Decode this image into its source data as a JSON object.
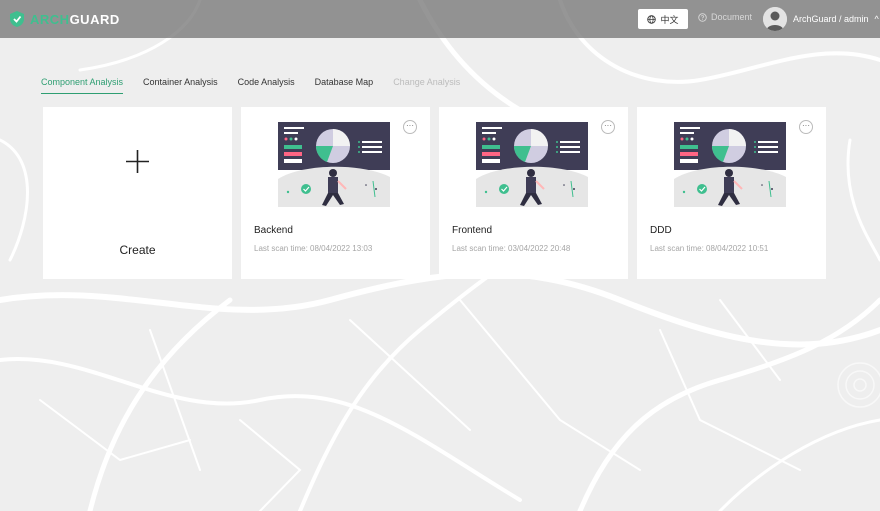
{
  "header": {
    "logo_text_a": "ARCH",
    "logo_text_b": "GUARD",
    "language_label": "中文",
    "document_label": "Document",
    "user_label": "ArchGuard / admin",
    "caret": "^"
  },
  "tabs": [
    {
      "label": "Component Analysis",
      "state": "active"
    },
    {
      "label": "Container Analysis",
      "state": "normal"
    },
    {
      "label": "Code Analysis",
      "state": "normal"
    },
    {
      "label": "Database Map",
      "state": "normal"
    },
    {
      "label": "Change Analysis",
      "state": "disabled"
    }
  ],
  "create_card": {
    "label": "Create"
  },
  "systems": [
    {
      "name": "Backend",
      "last_scan": "Last scan time: 08/04/2022 13:03"
    },
    {
      "name": "Frontend",
      "last_scan": "Last scan time: 03/04/2022 20:48"
    },
    {
      "name": "DDD",
      "last_scan": "Last scan time: 08/04/2022 10:51"
    }
  ],
  "colors": {
    "accent": "#2e9e72",
    "topbar": "#787878",
    "card": "#ffffff"
  }
}
